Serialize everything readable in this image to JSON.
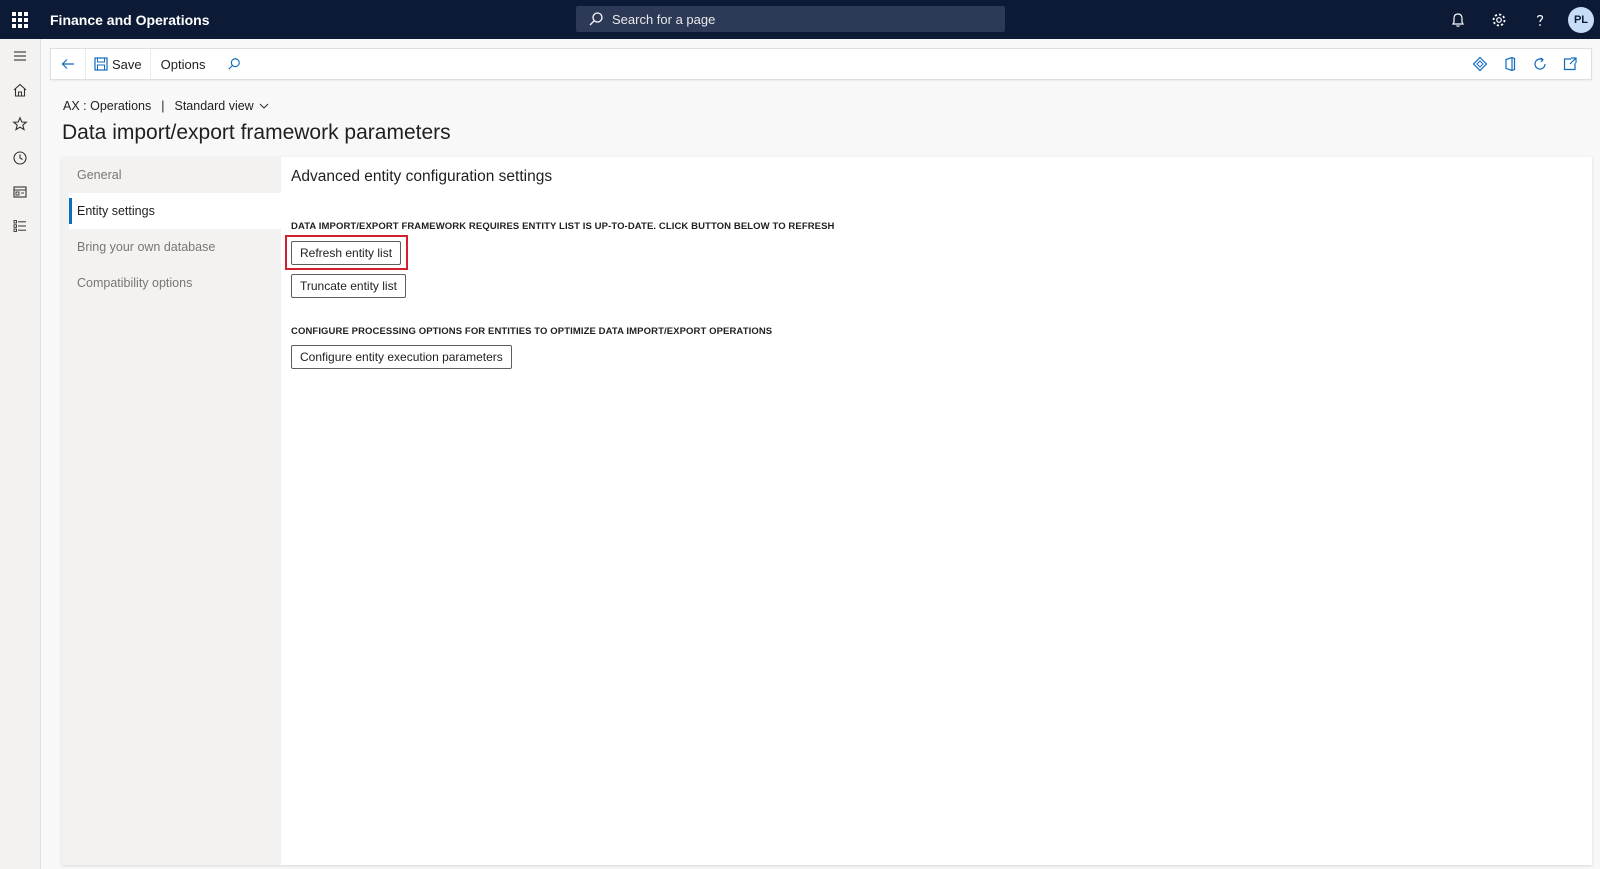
{
  "topbar": {
    "app_title": "Finance and Operations",
    "search_placeholder": "Search for a page",
    "user_initials": "PL",
    "icons": [
      "waffle-icon",
      "search-icon",
      "bell-icon",
      "gear-icon",
      "help-icon"
    ]
  },
  "rail": {
    "icons": [
      "hamburger-icon",
      "home-icon",
      "star-icon",
      "clock-icon",
      "workspace-icon",
      "list-icon"
    ]
  },
  "actionpane": {
    "save_label": "Save",
    "options_label": "Options",
    "right_icons": [
      "diamond-icon",
      "office-icon",
      "refresh-icon",
      "popout-icon"
    ]
  },
  "header": {
    "company": "AX : Operations",
    "view_name": "Standard view",
    "page_title": "Data import/export framework parameters"
  },
  "tabs": [
    {
      "label": "General",
      "active": false
    },
    {
      "label": "Entity settings",
      "active": true
    },
    {
      "label": "Bring your own database",
      "active": false
    },
    {
      "label": "Compatibility options",
      "active": false
    }
  ],
  "content": {
    "section_title": "Advanced entity configuration settings",
    "group1_caption": "DATA IMPORT/EXPORT FRAMEWORK REQUIRES ENTITY LIST IS UP-TO-DATE. CLICK BUTTON BELOW TO REFRESH",
    "refresh_button": "Refresh entity list",
    "truncate_button": "Truncate entity list",
    "group2_caption": "CONFIGURE PROCESSING OPTIONS FOR ENTITIES TO OPTIMIZE DATA IMPORT/EXPORT OPERATIONS",
    "configure_button": "Configure entity execution parameters"
  },
  "colors": {
    "topbar_bg": "#0c1a35",
    "accent": "#0f6cbd",
    "highlight": "#d1202f"
  }
}
